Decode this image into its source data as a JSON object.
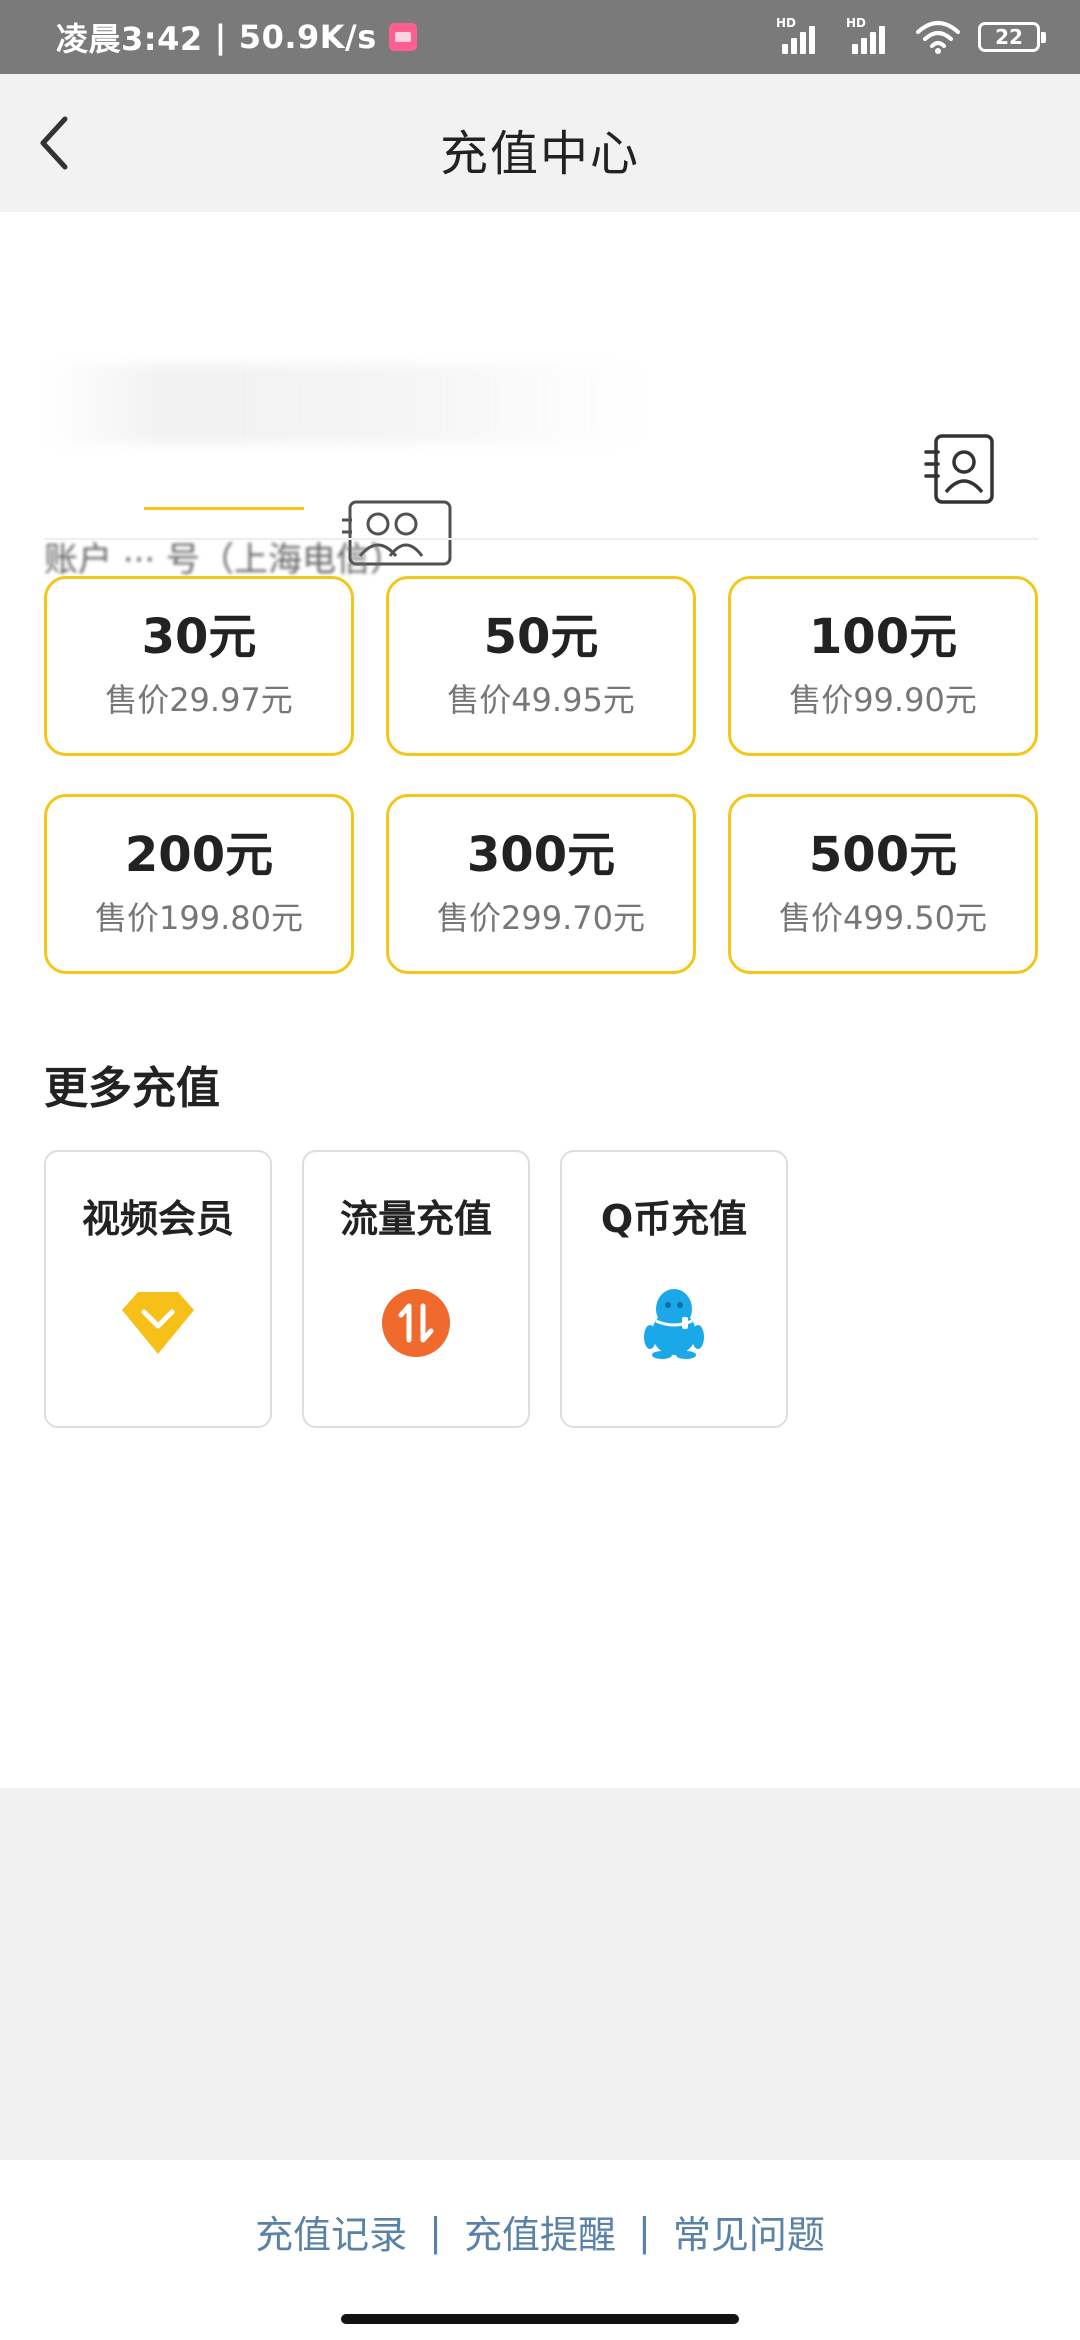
{
  "status_bar": {
    "time": "凌晨3:42",
    "separator": "|",
    "network_speed": "50.9K/s",
    "signal_1_label": "HD",
    "signal_2_label": "HD",
    "battery_level": "22",
    "app_icon": "pink-app-icon",
    "wifi_icon": "wifi-icon"
  },
  "header": {
    "title": "充值中心",
    "back_icon": "chevron-left-icon"
  },
  "account": {
    "phone_number": "",
    "description": "账户 ··· 号（上海电信）",
    "contact_icon": "contact-book-icon"
  },
  "recharge_options": [
    {
      "amount": "30元",
      "price": "售价29.97元"
    },
    {
      "amount": "50元",
      "price": "售价49.95元"
    },
    {
      "amount": "100元",
      "price": "售价99.90元"
    },
    {
      "amount": "200元",
      "price": "售价199.80元"
    },
    {
      "amount": "300元",
      "price": "售价299.70元"
    },
    {
      "amount": "500元",
      "price": "售价499.50元"
    }
  ],
  "more": {
    "title": "更多充值",
    "items": [
      {
        "label": "视频会员",
        "icon": "diamond-icon"
      },
      {
        "label": "流量充值",
        "icon": "data-transfer-icon"
      },
      {
        "label": "Q币充值",
        "icon": "qq-penguin-icon"
      }
    ]
  },
  "footer": {
    "links": [
      "充值记录",
      "充值提醒",
      "常见问题"
    ],
    "separator": "|"
  },
  "colors": {
    "accent": "#f3c61a",
    "link": "#5a82a8",
    "diamond": "#f7c019",
    "data": "#f06a2e",
    "qq": "#1aa8e8"
  }
}
